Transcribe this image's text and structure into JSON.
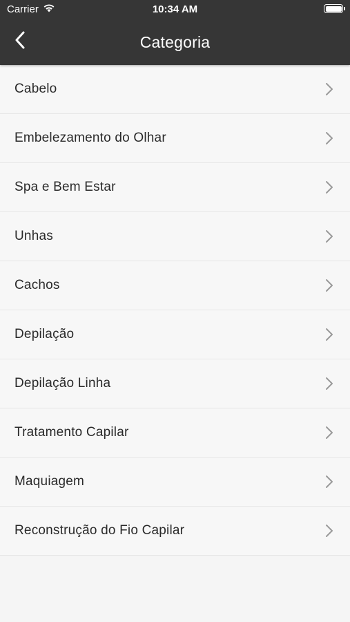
{
  "status_bar": {
    "carrier": "Carrier",
    "time": "10:34 AM"
  },
  "nav": {
    "title": "Categoria"
  },
  "categories": [
    {
      "label": "Cabelo"
    },
    {
      "label": "Embelezamento do Olhar"
    },
    {
      "label": "Spa e Bem Estar"
    },
    {
      "label": "Unhas"
    },
    {
      "label": "Cachos"
    },
    {
      "label": "Depilação"
    },
    {
      "label": "Depilação Linha"
    },
    {
      "label": "Tratamento Capilar"
    },
    {
      "label": "Maquiagem"
    },
    {
      "label": "Reconstrução do Fio Capilar"
    }
  ],
  "colors": {
    "header_bg": "#363636",
    "list_bg": "#f7f7f7",
    "chevron": "#9a9a9a"
  },
  "icons": {
    "back": "chevron-left-icon",
    "item_disclosure": "chevron-right-icon",
    "wifi": "wifi-icon",
    "battery": "battery-icon"
  }
}
